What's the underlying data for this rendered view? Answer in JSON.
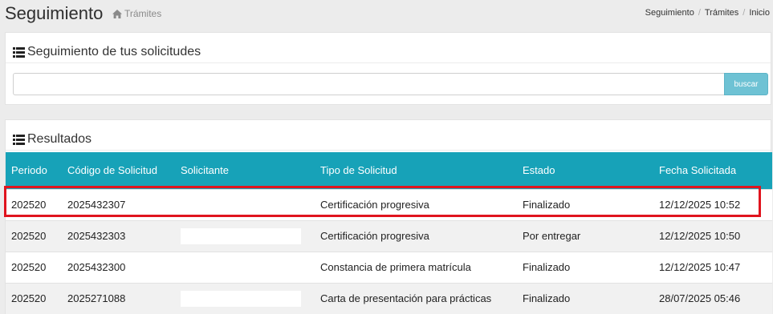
{
  "header": {
    "title": "Seguimiento",
    "subtitle": "Trámites",
    "breadcrumb": [
      "Seguimiento",
      "Trámites",
      "Inicio"
    ]
  },
  "search_panel": {
    "title": "Seguimiento de tus solicitudes",
    "input_value": "",
    "button_label": "buscar"
  },
  "results_panel": {
    "title": "Resultados",
    "columns": [
      "Periodo",
      "Código de Solicitud",
      "Solicitante",
      "Tipo de Solicitud",
      "Estado",
      "Fecha Solicitada"
    ],
    "rows": [
      {
        "periodo": "202520",
        "codigo": "2025432307",
        "solicitante": "",
        "tipo": "Certificación progresiva",
        "estado": "Finalizado",
        "fecha": "12/12/2025 10:52"
      },
      {
        "periodo": "202520",
        "codigo": "2025432303",
        "solicitante": "",
        "tipo": "Certificación progresiva",
        "estado": "Por entregar",
        "fecha": "12/12/2025 10:50"
      },
      {
        "periodo": "202520",
        "codigo": "2025432300",
        "solicitante": "",
        "tipo": "Constancia de primera matrícula",
        "estado": "Finalizado",
        "fecha": "12/12/2025 10:47"
      },
      {
        "periodo": "202520",
        "codigo": "2025271088",
        "solicitante": "",
        "tipo": "Carta de presentación para prácticas",
        "estado": "Finalizado",
        "fecha": "28/07/2025 05:46"
      }
    ]
  },
  "colors": {
    "table_header": "#17a2b8",
    "button": "#6ec2d4",
    "highlight": "#e0141e"
  },
  "icons": {
    "home": "home-icon",
    "list": "list-icon"
  }
}
